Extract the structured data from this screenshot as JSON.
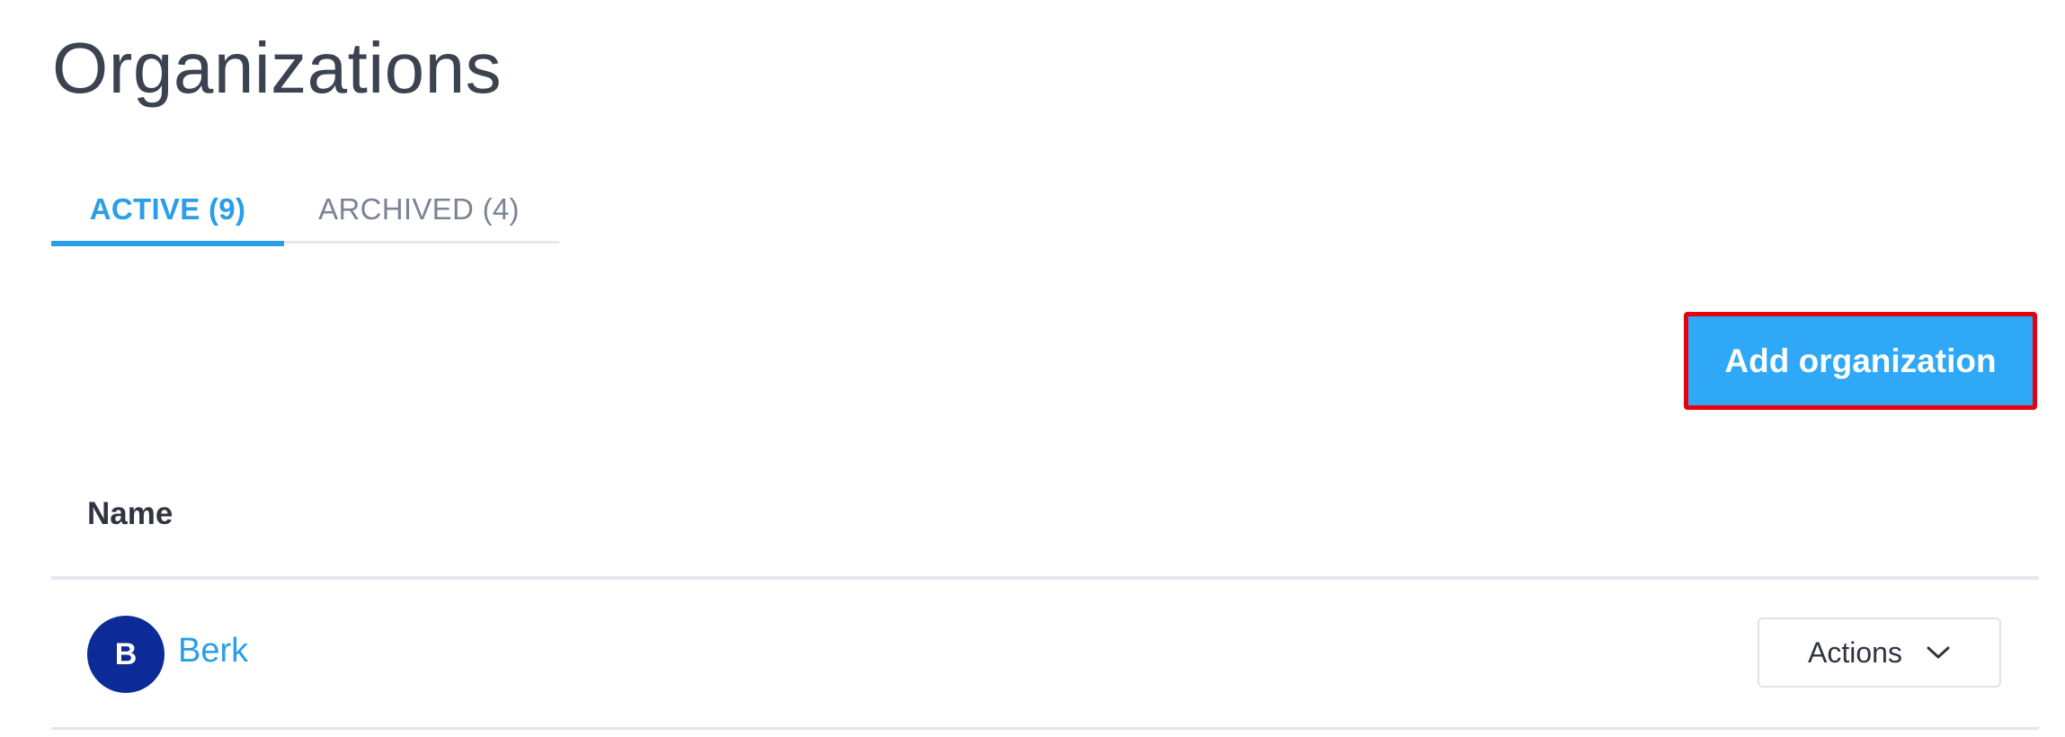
{
  "page": {
    "title": "Organizations"
  },
  "tabs": [
    {
      "label": "ACTIVE (9)",
      "active": true
    },
    {
      "label": "ARCHIVED (4)",
      "active": false
    }
  ],
  "toolbar": {
    "add_label": "Add organization"
  },
  "table": {
    "columns": [
      "Name"
    ],
    "rows": [
      {
        "avatar_initial": "B",
        "avatar_color": "#0d2b96",
        "name": "Berk",
        "actions_label": "Actions",
        "actions_icon": "chevron-down-icon"
      }
    ]
  },
  "colors": {
    "accent": "#2a9ee8",
    "button": "#2ea8f7",
    "highlight_border": "#e8000f"
  }
}
